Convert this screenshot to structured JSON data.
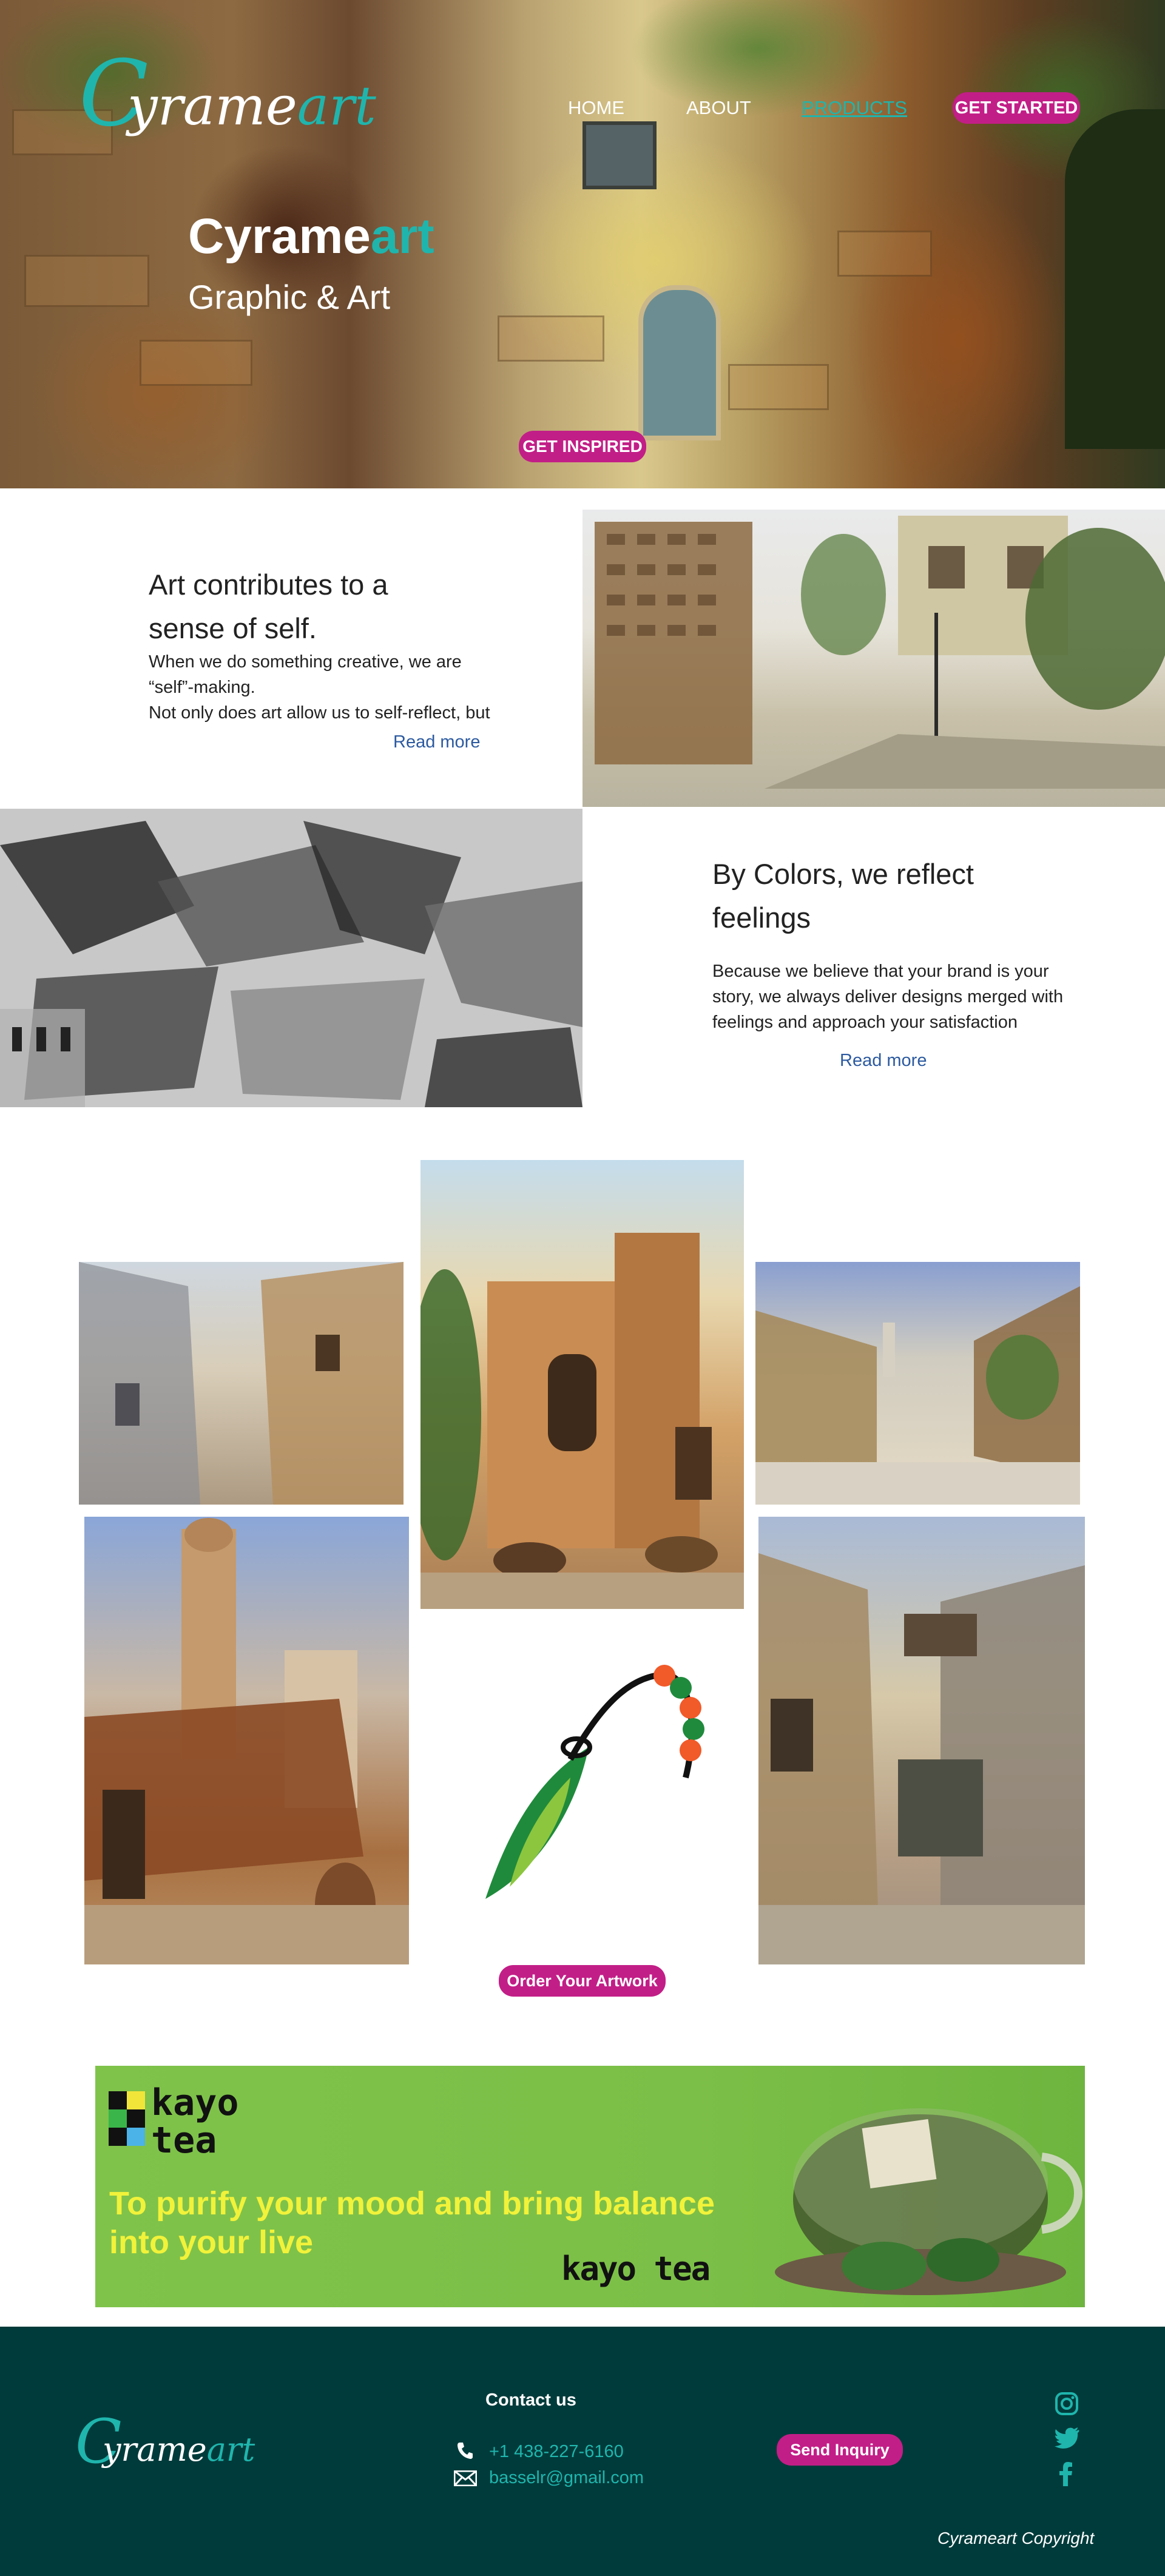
{
  "header": {
    "logo": {
      "initial": "C",
      "word_main": "yrame",
      "word_accent": "art"
    },
    "nav": [
      {
        "label": "HOME"
      },
      {
        "label": "ABOUT"
      },
      {
        "label": "PRODUCTS",
        "active": true
      }
    ],
    "cta_label": "GET STARTED"
  },
  "hero": {
    "title_main": "Cyrame",
    "title_accent": "art",
    "subtitle": "Graphic & Art",
    "button_label": "GET INSPIRED"
  },
  "section1": {
    "heading": "Art contributes to a sense of self.",
    "body_lines": [
      "When we do something creative, we are",
      "“self”-making.",
      "Not only does art allow us to self-reflect, but"
    ],
    "read_more": "Read more"
  },
  "section2": {
    "heading": "By Colors, we reflect feelings",
    "body_lines": [
      "Because we believe that your brand is your",
      "story, we always deliver designs merged with",
      "feelings and approach your satisfaction"
    ],
    "read_more": "Read more"
  },
  "gallery": {
    "order_button": "Order Your Artwork"
  },
  "banner": {
    "logo_lines": [
      "kayo",
      "tea"
    ],
    "tagline_line1": "To purify your mood and bring balance",
    "tagline_line2": "into your live",
    "brand": "kayo tea"
  },
  "footer": {
    "logo": {
      "initial": "C",
      "word_main": "yrame",
      "word_accent": "art"
    },
    "contact_title": "Contact us",
    "phone": "+1 438-227-6160",
    "email": "basselr@gmail.com",
    "inquiry_button": "Send Inquiry",
    "social": [
      "instagram-icon",
      "twitter-icon",
      "facebook-icon"
    ],
    "copyright": "Cyrameart Copyright"
  },
  "colors": {
    "accent_teal": "#1fb5ad",
    "button_magenta": "#c21e87",
    "footer_bg": "#003b3b",
    "link_blue": "#2c5aa0",
    "banner_green": "#7fc34a",
    "banner_yellow": "#f1f23a"
  }
}
